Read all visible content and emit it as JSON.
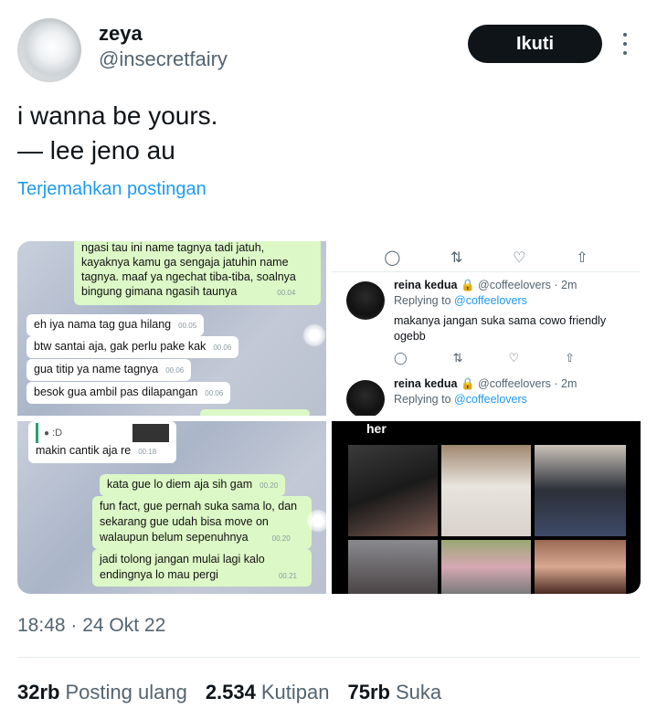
{
  "author": {
    "display_name": "zeya",
    "handle": "@insecretfairy",
    "follow_label": "Ikuti"
  },
  "tweet": {
    "line1": "i wanna be yours.",
    "line2": "— lee jeno au",
    "translate_label": "Terjemahkan postingan",
    "timestamp": "18:48 · 24 Okt 22"
  },
  "media": {
    "chat1": [
      {
        "text": "ngasi tau ini name tagnya tadi jatuh,",
        "ts": ""
      },
      {
        "text": "kayaknya kamu ga sengaja jatuhin name",
        "ts": ""
      },
      {
        "text": "tagnya. maaf ya ngechat tiba-tiba, soalnya",
        "ts": ""
      },
      {
        "text": "bingung gimana ngasih taunya",
        "ts": "00.04"
      },
      {
        "text": "eh iya nama tag gua hilang",
        "ts": "00.05"
      },
      {
        "text": "btw santai aja, gak perlu pake kak",
        "ts": "00.06"
      },
      {
        "text": "gua titip ya name tagnya",
        "ts": "00.06"
      },
      {
        "text": "besok gua ambil pas dilapangan",
        "ts": "00.06"
      }
    ],
    "thread": {
      "reply1": {
        "name": "reina kedua",
        "meta": "@coffeelovers · 2m",
        "replying_prefix": "Replying to",
        "replying_to": "@coffeelovers",
        "text": "makanya jangan suka sama cowo friendly ogebb"
      },
      "reply2": {
        "name": "reina kedua",
        "meta": "@coffeelovers · 2m",
        "replying_prefix": "Replying to",
        "replying_to": "@coffeelovers"
      }
    },
    "chat2": [
      {
        "text": "makin cantik aja re",
        "ts": "00.18"
      },
      {
        "text": "kata gue lo diem aja sih gam",
        "ts": "00.20"
      },
      {
        "text": "fun fact, gue pernah suka sama lo, dan",
        "ts": ""
      },
      {
        "text": "sekarang gue udah bisa move on",
        "ts": ""
      },
      {
        "text": "walaupun belum sepenuhnya",
        "ts": "00.20"
      },
      {
        "text": "jadi tolong jangan mulai lagi kalo",
        "ts": ""
      },
      {
        "text": "endingnya lo mau pergi",
        "ts": "00.21"
      }
    ],
    "chat2_quote": ":D",
    "collage_label": "her"
  },
  "stats": {
    "retweets": "32rb",
    "retweets_label": "Posting ulang",
    "quotes": "2.534",
    "quotes_label": "Kutipan",
    "likes": "75rb",
    "likes_label": "Suka"
  }
}
